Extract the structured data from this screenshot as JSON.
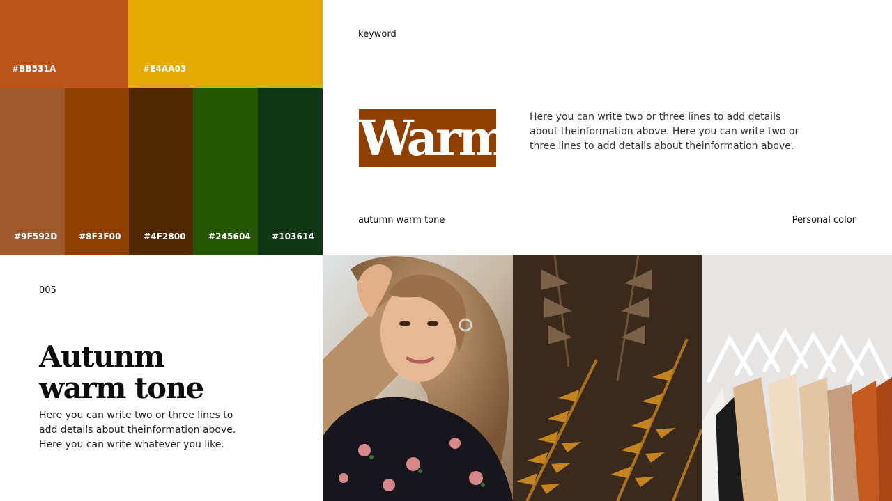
{
  "palette": {
    "top": [
      {
        "code": "#BB531A",
        "color": "#BB531A"
      },
      {
        "code": "#E4AA03",
        "color": "#E4AA03"
      }
    ],
    "bottom": [
      {
        "code": "#9F592D",
        "color": "#9F592D"
      },
      {
        "code": "#8F3F00",
        "color": "#8F3F00"
      },
      {
        "code": "#4F2800",
        "color": "#4F2800"
      },
      {
        "code": "#245604",
        "color": "#245604"
      },
      {
        "code": "#103614",
        "color": "#103614"
      }
    ]
  },
  "keyword_card": {
    "keyword_label": "keyword",
    "keyword": "Warm",
    "description": "Here you can write two or three lines to add details about theinformation above. Here you can write two or three lines to add details about theinformation above.",
    "tone_label": "autumn warm tone",
    "category_label": "Personal color"
  },
  "intro": {
    "page_number": "005",
    "title_line1": "Autunm",
    "title_line2": "warm tone",
    "description": "Here you can write two or three lines to add details about theinformation above. Here you can write whatever you like."
  },
  "photos": [
    {
      "name": "portrait-photo",
      "icon": "woman-portrait-image"
    },
    {
      "name": "fern-photo",
      "icon": "fern-leaves-image"
    },
    {
      "name": "clothing-rack-photo",
      "icon": "clothes-on-hangers-image"
    }
  ]
}
